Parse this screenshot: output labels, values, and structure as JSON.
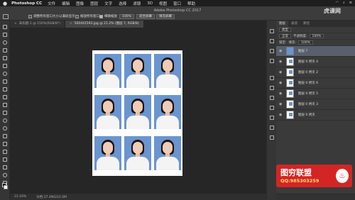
{
  "menubar": {
    "apple": "",
    "app_name": "Photoshop CC",
    "items": [
      "文件",
      "编辑",
      "图像",
      "图层",
      "文字",
      "选择",
      "滤镜",
      "3D",
      "视图",
      "窗口",
      "帮助"
    ]
  },
  "window": {
    "title": "Adobe Photoshop CC 2017"
  },
  "options": {
    "check1_label": "调整所有窗口大小以满屏显示",
    "check2_label": "缩放所有窗口",
    "check3_label": "细微缩放",
    "zoom_value": "100%",
    "fit_screen_label": "适合屏幕",
    "fill_screen_label": "填充屏幕"
  },
  "tabs": [
    {
      "close": "×",
      "label": "未标题-1 @ 150%(RGB/8*)"
    },
    {
      "close": "×",
      "label": "500441593.jpg @ 21.2% (图层 7, RGB/8)"
    }
  ],
  "status": {
    "zoom": "21.16%",
    "doc_size": "文档:37.4M/222.0M"
  },
  "panel": {
    "tabs": [
      "图层",
      "通道",
      "路径"
    ],
    "filter_label": "类型",
    "blend_mode": "正常",
    "opacity_label": "不透明度:",
    "opacity_value": "100%",
    "lock_label": "锁定:",
    "fill_label": "填充:",
    "fill_value": "100%",
    "layers": [
      {
        "name": "图层 7",
        "selected": true
      },
      {
        "name": "图层 0 拷贝 4",
        "selected": false
      },
      {
        "name": "图层 0 拷贝 2",
        "selected": false
      },
      {
        "name": "图层 0 拷贝 6",
        "selected": false
      },
      {
        "name": "图层 0 拷贝 5",
        "selected": false
      },
      {
        "name": "图层 0 拷贝 3",
        "selected": false
      },
      {
        "name": "图层 0 拷贝",
        "selected": false
      }
    ]
  },
  "watermark": {
    "top_right": "虎课网",
    "promo_title": "图穷联盟",
    "promo_qq": "QQ:985303259"
  },
  "colors": {
    "photo_background": "#6a95cf",
    "selected_layer": "#58606e",
    "promo_red": "#d42525"
  }
}
